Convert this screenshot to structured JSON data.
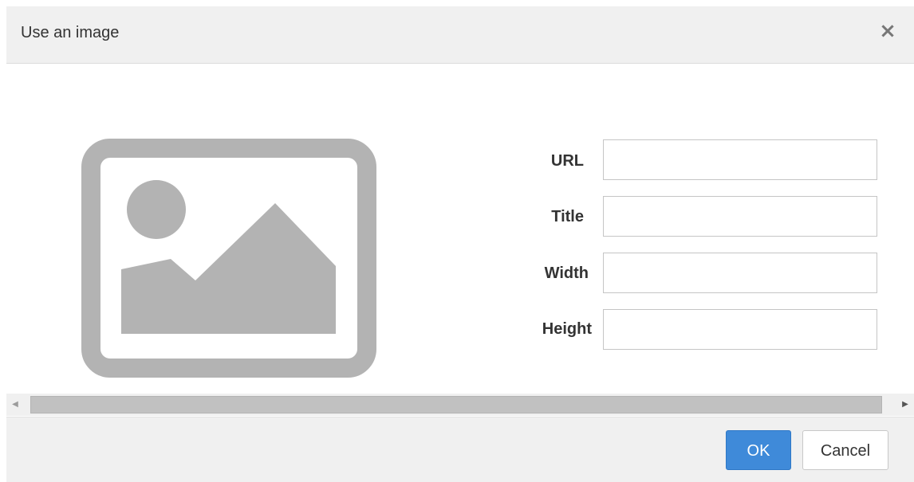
{
  "dialog": {
    "title": "Use an image",
    "close_glyph": "×"
  },
  "preview": {
    "icon": "image-placeholder-icon",
    "color": "#b3b3b3"
  },
  "form": {
    "url_label": "URL",
    "url_value": "",
    "title_label": "Title",
    "title_value": "",
    "width_label": "Width",
    "width_value": "",
    "height_label": "Height",
    "height_value": ""
  },
  "scrollbar": {
    "left_arrow": "◀",
    "right_arrow": "▶"
  },
  "footer": {
    "ok_label": "OK",
    "cancel_label": "Cancel",
    "ok_color": "#3f8ad9"
  }
}
